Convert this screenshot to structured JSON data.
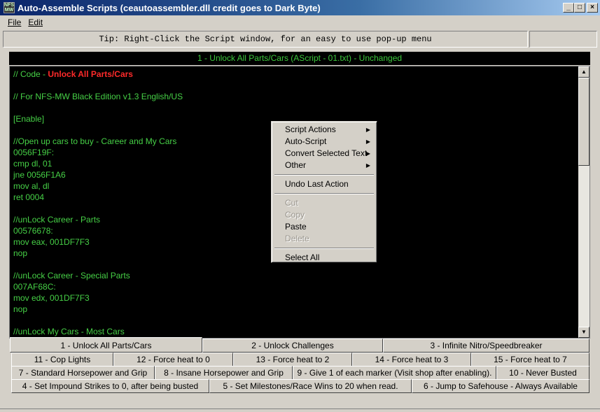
{
  "window": {
    "title": "Auto-Assemble Scripts (ceautoassembler.dll credit goes to Dark Byte)",
    "icon_text": "NFS MW"
  },
  "menu": [
    {
      "label": "File"
    },
    {
      "label": "Edit"
    }
  ],
  "tip": "Tip: Right-Click the Script window, for an easy to use pop-up menu",
  "header": "1 - Unlock All Parts/Cars  (AScript - 01.txt)  - Unchanged",
  "code": {
    "title_prefix": "// Code - ",
    "title_highlight": "Unlock All Parts/Cars",
    "lines": [
      "",
      "// For NFS-MW Black Edition v1.3 English/US",
      "",
      "[Enable]",
      "",
      "//Open up cars to buy - Career and My Cars",
      "0056F19F:",
      "cmp dl, 01",
      "jne 0056F1A6",
      "mov al, dl",
      "ret 0004",
      "",
      "//unLock Career - Parts",
      "00576678:",
      "mov eax, 001DF7F3",
      "nop",
      "",
      "//unLock Career - Special Parts",
      "007AF68C:",
      "mov edx, 001DF7F3",
      "nop",
      "",
      "//unLock My Cars - Most Cars"
    ]
  },
  "tabs": {
    "row1": [
      "1 - Unlock All Parts/Cars",
      "2 - Unlock Challenges",
      "3 - Infinite Nitro/Speedbreaker"
    ],
    "row2": [
      "11 - Cop Lights",
      "12 - Force heat to 0",
      "13 - Force heat to 2",
      "14 - Force heat to 3",
      "15 - Force heat to 7"
    ],
    "row3": [
      "7 - Standard Horsepower and Grip",
      "8 - Insane Horsepower and Grip",
      "9 - Give 1 of each marker (Visit shop after enabling).",
      "10 - Never Busted"
    ],
    "row4": [
      "4 - Set Impound Strikes to 0, after being busted",
      "5 - Set Milestones/Race Wins to 20 when read.",
      "6 - Jump to Safehouse - Always Available"
    ],
    "selected": "1 - Unlock All Parts/Cars"
  },
  "context_menu": {
    "submenus": [
      "Script Actions",
      "Auto-Script",
      "Convert Selected Text",
      "Other"
    ],
    "undo": "Undo Last Action",
    "edit": [
      {
        "label": "Cut",
        "enabled": false
      },
      {
        "label": "Copy",
        "enabled": false
      },
      {
        "label": "Paste",
        "enabled": true
      },
      {
        "label": "Delete",
        "enabled": false
      }
    ],
    "select_all": "Select All"
  },
  "colors": {
    "code_text": "#46d046",
    "highlight": "#ff2a2a",
    "editor_bg": "#000000"
  }
}
